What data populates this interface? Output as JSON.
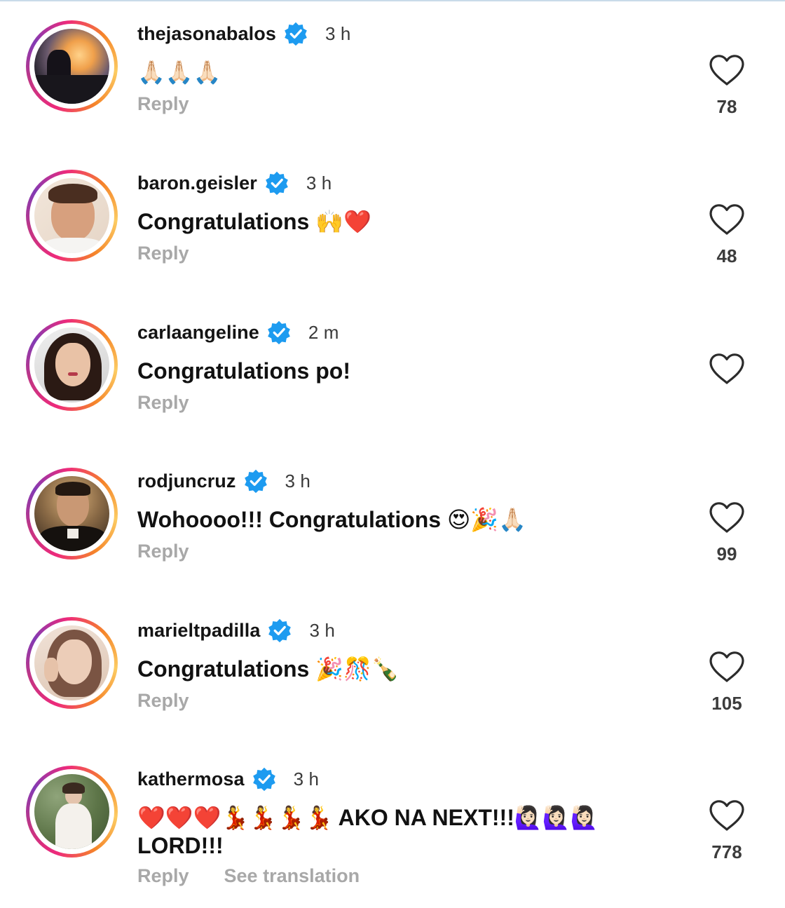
{
  "comments": [
    {
      "username": "thejasonabalos",
      "time": "3 h",
      "text": "🙏🏻🙏🏻🙏🏻",
      "reply_label": "Reply",
      "likes": "78",
      "avatar_colors": [
        "#f6b56a",
        "#2c2a36"
      ]
    },
    {
      "username": "baron.geisler",
      "time": "3 h",
      "text": "Congratulations 🙌❤️",
      "reply_label": "Reply",
      "likes": "48",
      "avatar_colors": [
        "#e9d9cb",
        "#b07a58"
      ]
    },
    {
      "username": "carlaangeline",
      "time": "2 m",
      "text": "Congratulations po!",
      "reply_label": "Reply",
      "likes": "",
      "avatar_colors": [
        "#dcdcdc",
        "#2a1a16"
      ]
    },
    {
      "username": "rodjuncruz",
      "time": "3 h",
      "text": "Wohoooo!!! Congratulations 😍🎉🙏🏻",
      "reply_label": "Reply",
      "likes": "99",
      "avatar_colors": [
        "#c59a66",
        "#1e1712"
      ]
    },
    {
      "username": "marieltpadilla",
      "time": "3 h",
      "text": "Congratulations 🎉🎊🍾",
      "reply_label": "Reply",
      "likes": "105",
      "avatar_colors": [
        "#e7d3c6",
        "#6d4b3d"
      ]
    },
    {
      "username": "kathermosa",
      "time": "3 h",
      "text": "❤️❤️❤️💃💃💃💃 AKO NA NEXT!!!🙋🏻‍♀️🙋🏻‍♀️🙋🏻‍♀️ LORD!!!",
      "reply_label": "Reply",
      "translate_label": "See translation",
      "likes": "778",
      "avatar_colors": [
        "#6f8a5c",
        "#f2efe9"
      ]
    }
  ],
  "colors": {
    "verified": "#1d9bf0",
    "muted_text": "#a8a8a8",
    "ring_start": "#ee2a7b",
    "ring_end": "#fccc63"
  },
  "icons": {
    "verified": "verified-badge-icon",
    "like": "heart-outline-icon"
  }
}
